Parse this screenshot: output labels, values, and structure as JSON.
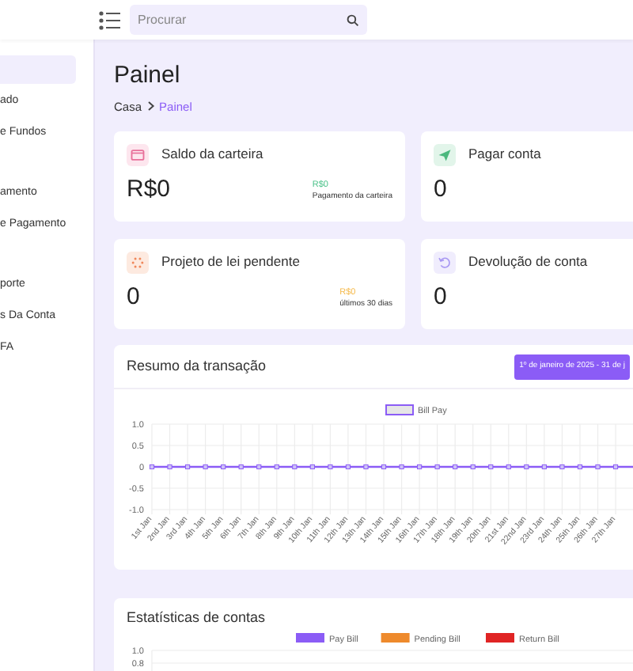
{
  "header": {
    "search": {
      "placeholder": "Procurar"
    }
  },
  "sidebar": {
    "groups": [
      {
        "items": [
          {
            "selected": true
          },
          {
            "label": "ado",
            "selected": false
          },
          {
            "label": "e Fundos",
            "selected": false
          }
        ]
      },
      {
        "items": [
          {
            "label": "amento",
            "selected": false
          },
          {
            "label": "e Pagamento",
            "selected": false
          }
        ]
      },
      {
        "items": [
          {
            "label": "porte",
            "selected": false
          },
          {
            "label": "s Da Conta",
            "selected": false
          },
          {
            "label": "FA",
            "selected": false
          }
        ]
      }
    ]
  },
  "page": {
    "title": "Painel",
    "breadcrumb": [
      {
        "label": "Casa",
        "current": false
      },
      {
        "label": "Painel",
        "current": true
      }
    ]
  },
  "stats": [
    {
      "kind": "wallet",
      "title": "Saldo da carteira",
      "value": "R$0",
      "note_amount": "R$0",
      "note_text": "Pagamento da carteira"
    },
    {
      "kind": "send",
      "title": "Pagar conta",
      "value": "0"
    },
    {
      "kind": "pending",
      "title": "Projeto de lei pendente",
      "value": "0",
      "note_amount": "R$0",
      "note_text": "últimos 30 dias"
    },
    {
      "kind": "return",
      "title": "Devolução de conta",
      "value": "0"
    }
  ],
  "transaction_summary": {
    "title": "Resumo da transação",
    "date_range": "1º de janeiro de 2025 - 31 de j",
    "chart_data": {
      "type": "line",
      "categories": [
        "1st Jan",
        "2nd Jan",
        "3rd Jan",
        "4th Jan",
        "5th Jan",
        "6th Jan",
        "7th Jan",
        "8th Jan",
        "9th Jan",
        "10th Jan",
        "11th Jan",
        "12th Jan",
        "13th Jan",
        "14th Jan",
        "15th Jan",
        "16th Jan",
        "17th Jan",
        "18th Jan",
        "19th Jan",
        "20th Jan",
        "21st Jan",
        "22nd Jan",
        "23rd Jan",
        "24th Jan",
        "25th Jan",
        "26th Jan",
        "27th Jan"
      ],
      "grid": true,
      "series": [
        {
          "name": "Bill Pay",
          "color": "#8b5cf6",
          "marker": true,
          "values": [
            0,
            0,
            0,
            0,
            0,
            0,
            0,
            0,
            0,
            0,
            0,
            0,
            0,
            0,
            0,
            0,
            0,
            0,
            0,
            0,
            0,
            0,
            0,
            0,
            0,
            0,
            0
          ]
        }
      ],
      "ylim": [
        -1,
        1
      ],
      "yticks": [
        {
          "value": -1,
          "label": "-1.0"
        },
        {
          "value": -0.5,
          "label": "-0.5"
        },
        {
          "value": 0,
          "label": "0"
        },
        {
          "value": 0.5,
          "label": "0.5"
        },
        {
          "value": 1,
          "label": "1.0"
        }
      ]
    }
  },
  "account_stats": {
    "title": "Estatísticas de contas",
    "chart_data": {
      "type": "bar",
      "series": [
        {
          "name": "Pay Bill",
          "color": "#8b5cf6"
        },
        {
          "name": "Pending Bill",
          "color": "#ee8a2c"
        },
        {
          "name": "Return Bill",
          "color": "#e02424"
        }
      ],
      "grid": true,
      "ylim": [
        0,
        1
      ],
      "yticks": [
        {
          "value": 0.8,
          "label": "0.8"
        },
        {
          "value": 1,
          "label": "1.0"
        }
      ]
    }
  }
}
